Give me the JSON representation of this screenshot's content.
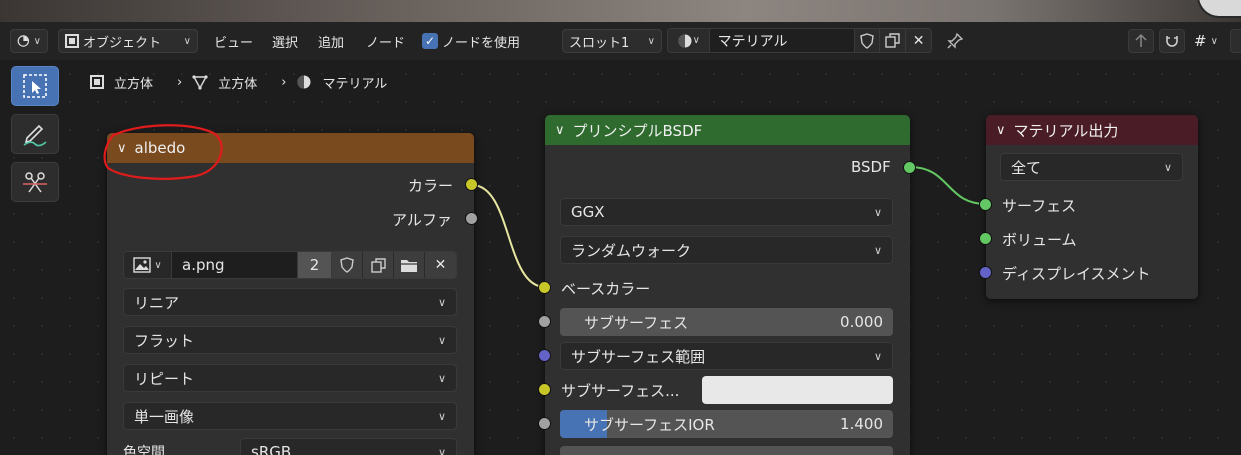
{
  "header": {
    "mode_label": "オブジェクト",
    "menu": [
      "ビュー",
      "選択",
      "追加",
      "ノード"
    ],
    "use_nodes_label": "ノードを使用",
    "use_nodes_checked": true,
    "slot_label": "スロット1",
    "material_name": "マテリアル"
  },
  "breadcrumb": [
    "立方体",
    "立方体",
    "マテリアル"
  ],
  "nodes": {
    "albedo": {
      "title": "albedo",
      "header_color": "#7a4a1f",
      "outputs": [
        "カラー",
        "アルファ"
      ],
      "image_name": "a.png",
      "image_users": "2",
      "interpolation": "リニア",
      "projection": "フラット",
      "extension": "リピート",
      "source": "単一画像",
      "colorspace_label": "色空間",
      "colorspace_value": "sRGB"
    },
    "principled": {
      "title": "プリンシプルBSDF",
      "header_color": "#2f6a2f",
      "output": "BSDF",
      "distribution": "GGX",
      "subsurface_method": "ランダムウォーク",
      "base_color_label": "ベースカラー",
      "subsurface_label": "サブサーフェス",
      "subsurface_value": "0.000",
      "subsurface_radius_label": "サブサーフェス範囲",
      "subsurface_color_label": "サブサーフェス...",
      "subsurface_ior_label": "サブサーフェスIOR",
      "subsurface_ior_value": "1.400",
      "subsurface_ior_fill": 0.14
    },
    "output": {
      "title": "マテリアル出力",
      "header_color": "#4a1d26",
      "target": "全て",
      "inputs": [
        "サーフェス",
        "ボリューム",
        "ディスプレイスメント"
      ]
    }
  },
  "colors": {
    "accent": "#4772b3",
    "annotation": "#e01b1b",
    "link_color": "#e6e6a0",
    "shader_link": "#63c763"
  }
}
